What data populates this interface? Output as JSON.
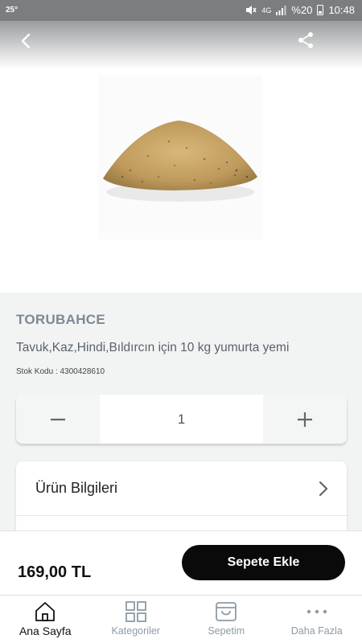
{
  "status_bar": {
    "temperature": "25°",
    "network": "4G",
    "battery": "%20",
    "time": "10:48"
  },
  "header": {
    "back_icon": "back-arrow-icon",
    "share_icon": "share-icon"
  },
  "product": {
    "image_icon": "product-photo-grain-feed",
    "brand": "TORUBAHCE",
    "name": "Tavuk,Kaz,Hindi,Bıldırcın için 10 kg yumurta yemi",
    "stock_code": "Stok Kodu : 4300428610"
  },
  "quantity": {
    "minus": "−",
    "value": "1",
    "plus": "+"
  },
  "info_card": {
    "title": "Ürün Bilgileri",
    "chevron": "chevron-right-icon"
  },
  "purchase": {
    "price": "169,00 TL",
    "add_to_cart": "Sepete Ekle"
  },
  "tabs": [
    {
      "label": "Ana Sayfa",
      "icon": "home-icon",
      "active": true
    },
    {
      "label": "Kategoriler",
      "icon": "grid-icon",
      "active": false
    },
    {
      "label": "Sepetim",
      "icon": "cart-icon",
      "active": false
    },
    {
      "label": "Daha Fazla",
      "icon": "more-icon",
      "active": false
    }
  ],
  "colors": {
    "accent": "#0a0a0a",
    "brand_text": "#7b8a93",
    "tab_inactive": "#8e9aa3",
    "status_bar": "#7b7e80"
  }
}
